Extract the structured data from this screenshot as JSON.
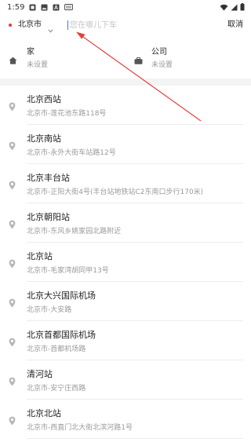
{
  "status_bar": {
    "time": "1:59",
    "left_icons": [
      "notification-icon",
      "gallery-icon",
      "a-icon",
      "keyboard-icon"
    ],
    "right_icons": [
      "wifi-icon",
      "signal-icon",
      "battery-icon"
    ]
  },
  "header": {
    "city": "北京市",
    "search_placeholder": "您在哪儿下车",
    "search_value": "",
    "cancel_label": "取消"
  },
  "shortcuts": {
    "home": {
      "title": "家",
      "subtitle": "未设置"
    },
    "work": {
      "title": "公司",
      "subtitle": "未设置"
    }
  },
  "results": [
    {
      "name": "北京西站",
      "address": "北京市-莲花池东路118号"
    },
    {
      "name": "北京南站",
      "address": "北京市-永外大街车站路12号"
    },
    {
      "name": "北京丰台站",
      "address": "北京市-正阳大街4号(丰台站地铁站C2东南口步行170米)"
    },
    {
      "name": "北京朝阳站",
      "address": "北京市-东风乡姚家园北路附近"
    },
    {
      "name": "北京站",
      "address": "北京市-毛家湾胡同甲13号"
    },
    {
      "name": "北京大兴国际机场",
      "address": "北京市-大安路"
    },
    {
      "name": "北京首都国际机场",
      "address": "北京市-首都机场路"
    },
    {
      "name": "清河站",
      "address": "北京市-安宁庄西路"
    },
    {
      "name": "北京北站",
      "address": "北京市-西直门北大街北滨河路1号"
    }
  ],
  "colors": {
    "accent_red": "#e5383b",
    "annotation_red": "#e0423f",
    "caret_blue": "#3a78e7",
    "secondary_text": "#9a9a9a",
    "divider": "#ececec",
    "section_gap": "#f4f4f4"
  }
}
